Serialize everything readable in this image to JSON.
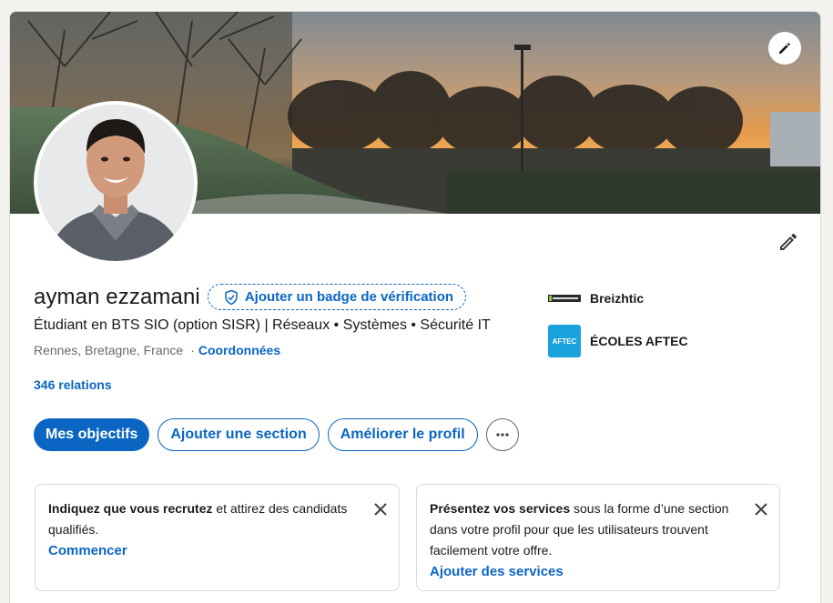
{
  "profile": {
    "name": "ayman ezzamani",
    "verify_badge_label": "Ajouter un badge de vérification",
    "headline": "Étudiant en BTS SIO (option SISR) | Réseaux • Systèmes • Sécurité IT",
    "location": "Rennes, Bretagne, France",
    "location_separator": "·",
    "contact_link": "Coordonnées",
    "relations": "346 relations"
  },
  "actions": {
    "primary": "Mes objectifs",
    "add_section": "Ajouter une section",
    "improve_profile": "Améliorer le profil",
    "more_icon": "ellipsis-icon"
  },
  "organizations": [
    {
      "name": "Breizhtic",
      "logo_icon": "breizhtic-logo",
      "logo_text": "BREIZHTIC"
    },
    {
      "name": "ÉCOLES AFTEC",
      "logo_icon": "aftec-logo",
      "logo_text": "AFTEC"
    }
  ],
  "promos": {
    "recruit": {
      "bold": "Indiquez que vous recrutez",
      "text": " et attirez des candidats qualifiés.",
      "link": "Commencer",
      "close_icon": "close-icon"
    },
    "services": {
      "bold": "Présentez vos services",
      "text": " sous la forme d’une section dans votre profil pour que les utilisateurs trouvent facilement votre offre.",
      "link": "Ajouter des services",
      "close_icon": "close-icon"
    }
  },
  "colors": {
    "brand_blue": "#0a66c2",
    "page_bg": "#f4f2ee",
    "aftec_blue": "#1aa2dd"
  },
  "icons": {
    "banner_edit": "pencil-icon",
    "profile_edit": "pencil-icon",
    "verify_shield": "shield-check-icon"
  }
}
